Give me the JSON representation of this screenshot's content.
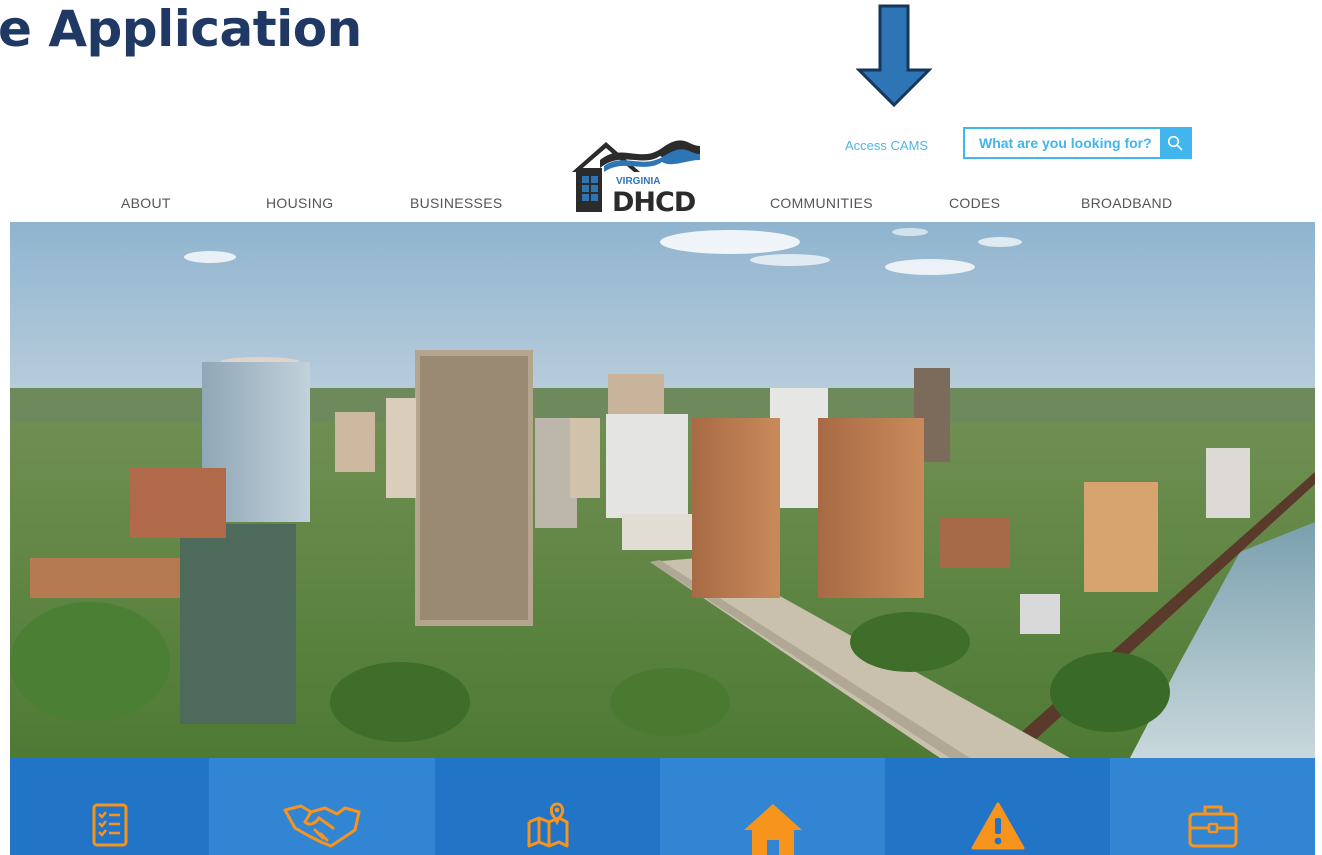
{
  "slide": {
    "title": "e Application"
  },
  "header": {
    "access_link": "Access CAMS",
    "search": {
      "placeholder": "What are you looking for?"
    },
    "logo": {
      "line1": "VIRGINIA",
      "line2": "DHCD"
    }
  },
  "nav": {
    "about": "ABOUT",
    "housing": "HOUSING",
    "businesses": "BUSINESSES",
    "communities": "COMMUNITIES",
    "codes": "CODES",
    "broadband": "BROADBAND"
  },
  "tiles": [
    {
      "icon": "checklist-icon"
    },
    {
      "icon": "handshake-icon"
    },
    {
      "icon": "map-pin-icon"
    },
    {
      "icon": "home-icon"
    },
    {
      "icon": "warning-icon"
    },
    {
      "icon": "briefcase-icon"
    }
  ],
  "colors": {
    "title": "#1f3864",
    "arrow": "#2e75b6",
    "accent": "#41b5ec",
    "tile_dark": "#2274c6",
    "tile_light": "#3185d3",
    "icon": "#f7941d"
  }
}
